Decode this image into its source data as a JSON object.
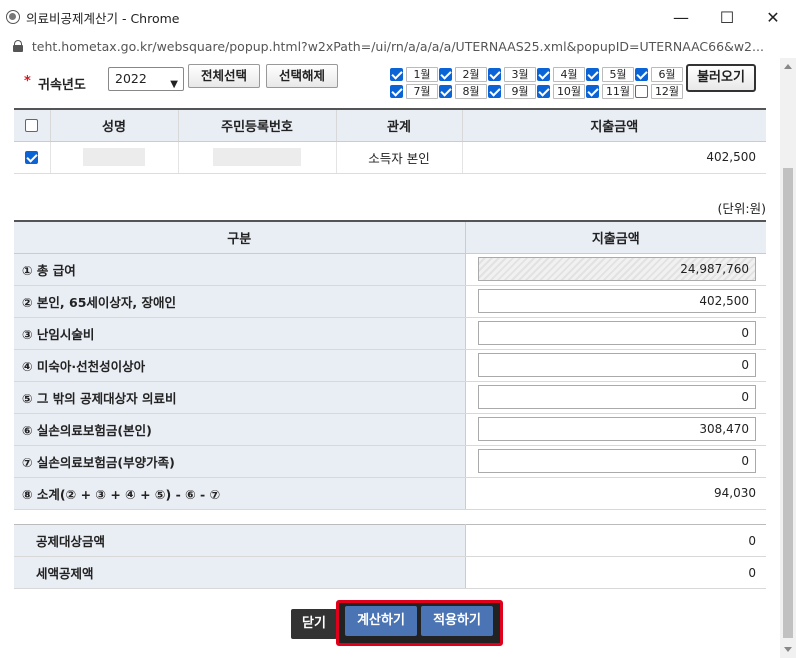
{
  "window": {
    "title": "의료비공제계산기 - Chrome",
    "minimize": "—",
    "maximize": "☐",
    "close": "✕"
  },
  "address": {
    "url": "teht.hometax.go.kr/websquare/popup.html?w2xPath=/ui/rn/a/a/a/a/UTERNAAS25.xml&popupID=UTERNAAC66&w2..."
  },
  "filter": {
    "required_mark": "*",
    "year_label": "귀속년도",
    "year_value": "2022",
    "select_all": "전체선택",
    "deselect_all": "선택해제",
    "load": "불러오기",
    "months": [
      {
        "label": "1월",
        "checked": true
      },
      {
        "label": "2월",
        "checked": true
      },
      {
        "label": "3월",
        "checked": true
      },
      {
        "label": "4월",
        "checked": true
      },
      {
        "label": "5월",
        "checked": true
      },
      {
        "label": "6월",
        "checked": true
      },
      {
        "label": "7월",
        "checked": true
      },
      {
        "label": "8월",
        "checked": true
      },
      {
        "label": "9월",
        "checked": true
      },
      {
        "label": "10월",
        "checked": true
      },
      {
        "label": "11월",
        "checked": true
      },
      {
        "label": "12월",
        "checked": false
      }
    ]
  },
  "people_table": {
    "headers": [
      "성명",
      "주민등록번호",
      "관계",
      "지출금액"
    ],
    "rows": [
      {
        "checked": true,
        "relation": "소득자 본인",
        "amount": "402,500"
      }
    ]
  },
  "unit": "(단위:원)",
  "calc_table": {
    "headers": [
      "구분",
      "지출금액"
    ],
    "rows": [
      {
        "label": "① 총 급여",
        "value": "24,987,760",
        "readonly": true
      },
      {
        "label": "② 본인, 65세이상자, 장애인",
        "value": "402,500"
      },
      {
        "label": "③ 난임시술비",
        "value": "0"
      },
      {
        "label": "④ 미숙아·선천성이상아",
        "value": "0"
      },
      {
        "label": "⑤ 그 밖의 공제대상자 의료비",
        "value": "0"
      },
      {
        "label": "⑥ 실손의료보험금(본인)",
        "value": "308,470"
      },
      {
        "label": "⑦ 실손의료보험금(부양가족)",
        "value": "0"
      }
    ],
    "subtotal": {
      "label": "⑧ 소계(② + ③ + ④ + ⑤) - ⑥ - ⑦",
      "value": "94,030"
    }
  },
  "summary": [
    {
      "label": "공제대상금액",
      "value": "0"
    },
    {
      "label": "세액공제액",
      "value": "0"
    }
  ],
  "actions": {
    "close": "닫기",
    "calculate": "계산하기",
    "apply": "적용하기"
  },
  "colors": {
    "primary_button": "#4a74b4",
    "highlight_box": "#e0001b",
    "header_bg": "#e9edf4"
  }
}
